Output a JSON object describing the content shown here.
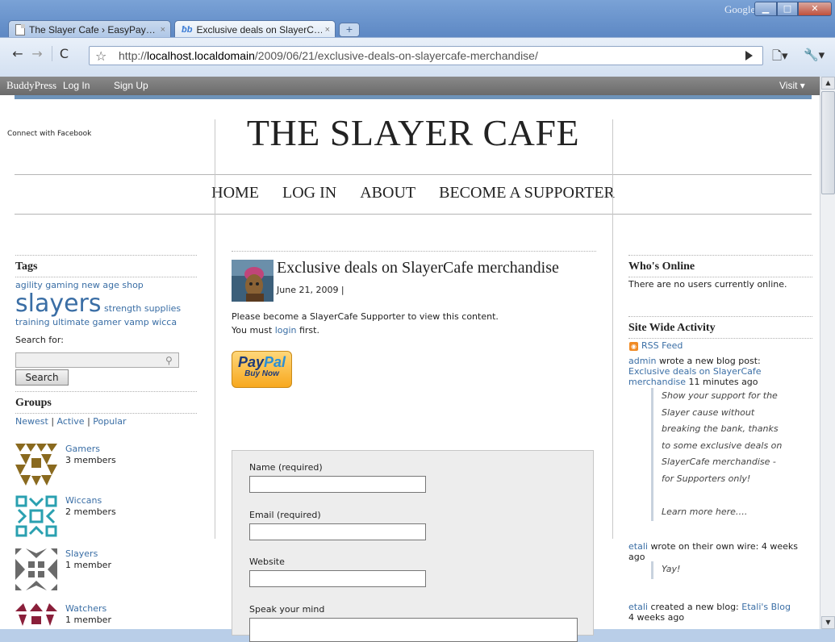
{
  "browser": {
    "tabs": [
      {
        "title": "The Slayer Cafe › EasyPay…",
        "close": "×"
      },
      {
        "title": "Exclusive deals on SlayerC…",
        "close": "×"
      }
    ],
    "new_tab": "+",
    "title_right": "Google",
    "url_prefix": "http://",
    "url_host": "localhost.localdomain",
    "url_path": "/2009/06/21/exclusive-deals-on-slayercafe-merchandise/"
  },
  "adminbar": {
    "logo": "BuddyPress",
    "login": "Log In",
    "signup": "Sign Up",
    "visit": "Visit"
  },
  "site": {
    "title": "THE SLAYER CAFE",
    "nav": [
      "HOME",
      "LOG IN",
      "ABOUT",
      "BECOME A SUPPORTER"
    ]
  },
  "left": {
    "facebook": "Connect with Facebook",
    "tags_heading": "Tags",
    "tags": {
      "line1": "agility gaming new age shop",
      "big": "slayers",
      "after_big": "strength supplies",
      "line3": "training ultimate gamer vamp wicca"
    },
    "search_label": "Search for:",
    "search_button": "Search",
    "groups_heading": "Groups",
    "group_tabs": {
      "newest": "Newest",
      "active": "Active",
      "popular": "Popular",
      "sep": "|"
    },
    "groups": [
      {
        "name": "Gamers",
        "members": "3 members",
        "color": "#8a6a1f"
      },
      {
        "name": "Wiccans",
        "members": "2 members",
        "color": "#2aa0b0"
      },
      {
        "name": "Slayers",
        "members": "1 member",
        "color": "#6a6a6a"
      },
      {
        "name": "Watchers",
        "members": "1 member",
        "color": "#8a1f3a"
      }
    ]
  },
  "post": {
    "title": "Exclusive deals on SlayerCafe merchandise",
    "date": "June 21, 2009 |",
    "body_line1": "Please become a SlayerCafe Supporter to view this content.",
    "body_prefix": "You must",
    "body_link": "login",
    "body_suffix": "first.",
    "paypal_pay": "Pay",
    "paypal_pal": "Pal",
    "paypal_sub": "Buy Now"
  },
  "form": {
    "name_label": "Name (required)",
    "email_label": "Email (required)",
    "website_label": "Website",
    "comment_label": "Speak your mind"
  },
  "right": {
    "whos_online_heading": "Who's Online",
    "whos_online_text": "There are no users currently online.",
    "activity_heading": "Site Wide Activity",
    "rss": "RSS Feed",
    "activities": [
      {
        "user": "admin",
        "action": "wrote a new blog post:",
        "link": "Exclusive deals on SlayerCafe merchandise",
        "time": "11 minutes ago",
        "quote": [
          "Show your support for the",
          "Slayer cause without",
          "breaking the bank, thanks",
          "to some exclusive deals on",
          "SlayerCafe merchandise -",
          "for Supporters only!",
          "",
          "Learn more here…."
        ]
      },
      {
        "user": "etali",
        "action": "wrote on their own wire:",
        "time": "4 weeks ago",
        "quote": [
          "Yay!"
        ]
      },
      {
        "user": "etali",
        "action": "created a new blog:",
        "link": "Etali's Blog",
        "time": "4 weeks ago"
      }
    ]
  }
}
